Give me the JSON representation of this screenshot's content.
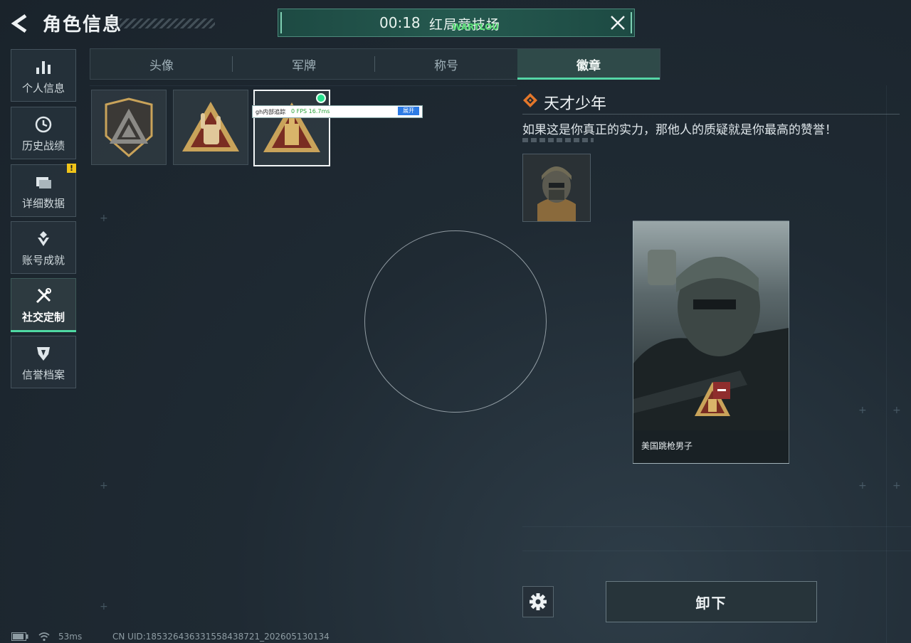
{
  "header": {
    "title": "角色信息",
    "match_timer": "00:18",
    "match_mode": "红局竞技场",
    "match_sub": "WARTLOU"
  },
  "sidebar": {
    "items": [
      {
        "label": "个人信息",
        "icon": "bar-chart-icon"
      },
      {
        "label": "历史战绩",
        "icon": "history-clock-icon"
      },
      {
        "label": "详细数据",
        "icon": "folder-data-icon",
        "alert": "!"
      },
      {
        "label": "账号成就",
        "icon": "achievement-icon"
      },
      {
        "label": "社交定制",
        "icon": "tools-icon",
        "active": true
      },
      {
        "label": "信誉档案",
        "icon": "credit-shield-icon"
      }
    ]
  },
  "tabs": [
    {
      "label": "头像"
    },
    {
      "label": "军牌"
    },
    {
      "label": "称号"
    },
    {
      "label": "徽章",
      "active": true
    }
  ],
  "badges": [
    {
      "icon": "shield-triangle-badge-icon"
    },
    {
      "icon": "hand-sign-badge-icon"
    },
    {
      "icon": "tower-triangle-badge-icon",
      "selected": true,
      "equipped": true
    }
  ],
  "perf_overlay": {
    "label": "gh内部追踪",
    "fps": "0 FPS  16.7ms",
    "button": "展开"
  },
  "detail": {
    "badge_name": "天才少年",
    "description": "如果这是你真正的实力，那他人的质疑就是你最高的赞誉！",
    "preview_name": "美国跳枪男子"
  },
  "actions": {
    "unequip_label": "卸下"
  },
  "status": {
    "ping": "53ms",
    "uid": "CN UID:185326436331558438721_202605130134"
  },
  "colors": {
    "accent": "#55d6a6",
    "equipped": "#27e08e",
    "badge_gold": "#c9a35a",
    "badge_red": "#8f2d2d"
  }
}
